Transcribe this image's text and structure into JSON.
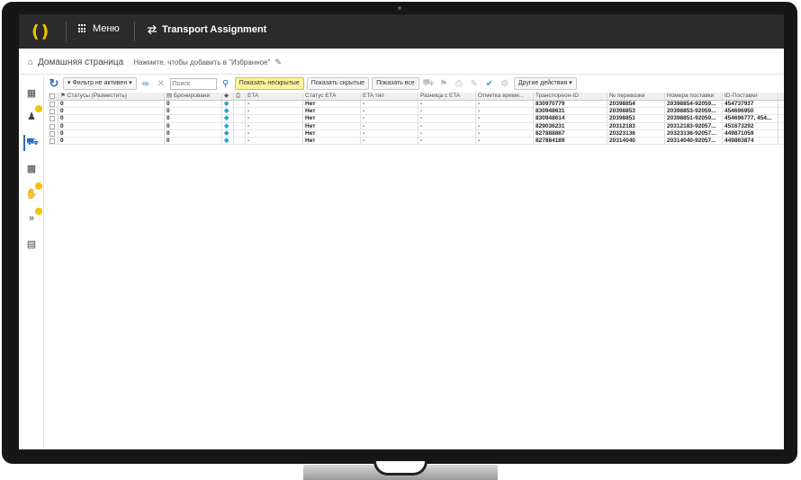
{
  "topbar": {
    "logo": "()",
    "menu_label": "Меню",
    "app_title": "Transport Assignment"
  },
  "breadcrumb": {
    "home": "Домашняя страница",
    "hint": "Нажмите, чтобы добавить в \"Избранное\""
  },
  "toolbar": {
    "filter_label": "Фильтр не активен",
    "search_placeholder": "Поиск",
    "show_unhidden": "Показать нескрытые",
    "show_hidden": "Показать скрытые",
    "show_all": "Показать все",
    "other_actions": "Другие действия"
  },
  "table": {
    "headers": {
      "status": "Статусы (Разместить)",
      "booking": "Бронировани",
      "eta": "ETA",
      "eta_status": "Статус ETA",
      "eta_type": "ETA тип",
      "eta_diff": "Разница с ETA",
      "time_mark": "Отметка време...",
      "transporeon_id": "Транспореон-ID",
      "shipment_no": "№ перевозки",
      "delivery_numbers": "Номера поставки",
      "delivery_id": "ID-Поставки"
    },
    "rows": [
      {
        "status": "0",
        "booking": "0",
        "eta": "-",
        "eta_status": "Нет",
        "eta_type": "-",
        "eta_diff": "-",
        "time_mark": "-",
        "transporeon_id": "830970779",
        "shipment_no": "20398854",
        "delivery_numbers": "20398854-92059...",
        "delivery_id": "454737937"
      },
      {
        "status": "0",
        "booking": "0",
        "eta": "-",
        "eta_status": "Нет",
        "eta_type": "-",
        "eta_diff": "-",
        "time_mark": "-",
        "transporeon_id": "830948631",
        "shipment_no": "20398853",
        "delivery_numbers": "20398853-92059...",
        "delivery_id": "454696950"
      },
      {
        "status": "0",
        "booking": "0",
        "eta": "-",
        "eta_status": "Нет",
        "eta_type": "-",
        "eta_diff": "-",
        "time_mark": "-",
        "transporeon_id": "830948614",
        "shipment_no": "20398851",
        "delivery_numbers": "20398851-92059...",
        "delivery_id": "454696777, 454..."
      },
      {
        "status": "0",
        "booking": "0",
        "eta": "-",
        "eta_status": "Нет",
        "eta_type": "-",
        "eta_diff": "-",
        "time_mark": "-",
        "transporeon_id": "829036231",
        "shipment_no": "20312183",
        "delivery_numbers": "20312183-92057...",
        "delivery_id": "451673292"
      },
      {
        "status": "0",
        "booking": "0",
        "eta": "-",
        "eta_status": "Нет",
        "eta_type": "-",
        "eta_diff": "-",
        "time_mark": "-",
        "transporeon_id": "827888867",
        "shipment_no": "20323136",
        "delivery_numbers": "20323136-92057...",
        "delivery_id": "449871059"
      },
      {
        "status": "0",
        "booking": "0",
        "eta": "-",
        "eta_status": "Нет",
        "eta_type": "-",
        "eta_diff": "-",
        "time_mark": "-",
        "transporeon_id": "827884189",
        "shipment_no": "20314040",
        "delivery_numbers": "20314040-92057...",
        "delivery_id": "449863874"
      }
    ]
  },
  "colors": {
    "topbar": "#2b2b2b",
    "brand_yellow": "#f3c300",
    "accent_blue": "#2a6ebd",
    "active_filter": "#fbf39b"
  },
  "icons": {
    "logo": "bracket-logo-icon",
    "menu": "grid-menu-icon",
    "app": "transport-swap-icon",
    "home": "home-icon",
    "edit": "pencil-icon",
    "refresh": "refresh-icon",
    "search": "search-icon"
  }
}
